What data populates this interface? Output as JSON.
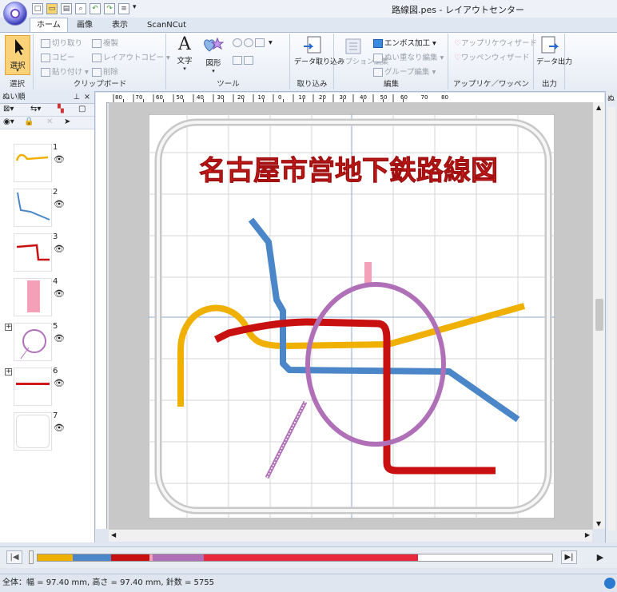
{
  "window": {
    "title": "路線図.pes - レイアウトセンター"
  },
  "tabs": [
    "ホーム",
    "画像",
    "表示",
    "ScanNCut"
  ],
  "ribbon": {
    "select": {
      "label": "選択",
      "group": "選択"
    },
    "clipboard": {
      "cut": "切り取り",
      "duplicate": "複製",
      "copy": "コピー",
      "layout_copy": "レイアウトコピー",
      "paste": "貼り付け",
      "delete": "削除",
      "group": "クリップボード"
    },
    "tools": {
      "text": "文字",
      "shape": "図形",
      "group": "ツール"
    },
    "import": {
      "data_import": "データ取り込み",
      "group": "取り込み"
    },
    "edit": {
      "option_edit": "オプション編集",
      "emboss": "エンボス加工",
      "stitch_overlap": "ぬい重なり編集",
      "group_edit": "グループ編集",
      "group": "編集"
    },
    "applique": {
      "applique_wizard": "アップリケウィザード",
      "patch_wizard": "ワッペンウィザード",
      "group": "アップリケ／ワッペン"
    },
    "output": {
      "data_output": "データ出力",
      "group": "出力"
    }
  },
  "left_panel": {
    "title": "ぬい順",
    "items": [
      {
        "num": "1",
        "color": "#f0b000"
      },
      {
        "num": "2",
        "color": "#4a86c8"
      },
      {
        "num": "3",
        "color": "#c81010"
      },
      {
        "num": "4",
        "color": "#f4a0b8"
      },
      {
        "num": "5",
        "color": "#b070b8"
      },
      {
        "num": "6",
        "color": "#d01818"
      },
      {
        "num": "7",
        "color": "#dddddd"
      }
    ]
  },
  "design": {
    "title": "名古屋市営地下鉄路線図",
    "colors": {
      "yellow": "#f0b000",
      "blue": "#4a86c8",
      "red": "#c81010",
      "pink": "#f4a0b8",
      "purple": "#b070b8",
      "frame": "#d8d8d8"
    }
  },
  "ruler": {
    "h_ticks": [
      "80",
      "70",
      "60",
      "50",
      "40",
      "30",
      "20",
      "10",
      "0",
      "10",
      "20",
      "30",
      "40",
      "50",
      "60",
      "70",
      "80"
    ]
  },
  "sequence": {
    "colors": [
      "#f0b000",
      "#4a86c8",
      "#c81010",
      "#b070b8",
      "#e8283c",
      "#ffffff"
    ]
  },
  "status": {
    "text": "全体：幅 = 97.40 mm, 高さ = 97.40 mm, 針数 = 5755"
  }
}
